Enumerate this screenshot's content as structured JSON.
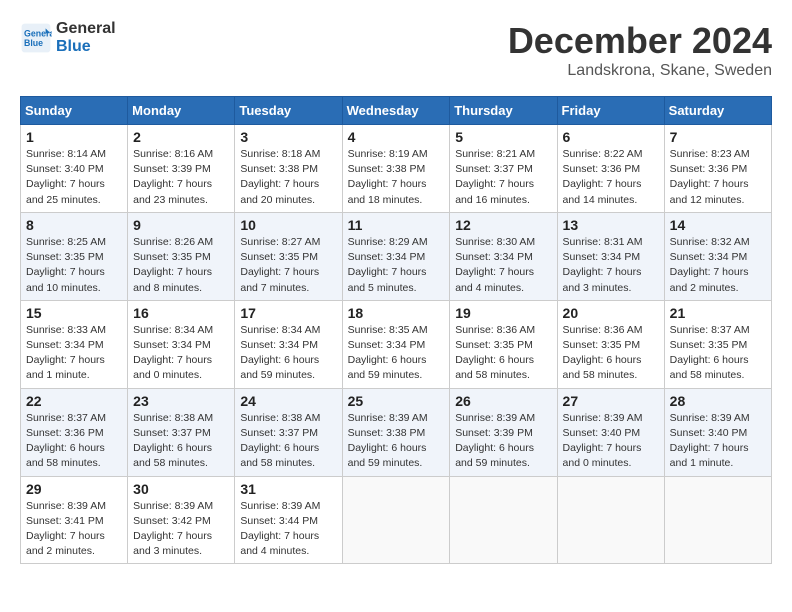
{
  "header": {
    "logo_line1": "General",
    "logo_line2": "Blue",
    "month_title": "December 2024",
    "location": "Landskrona, Skane, Sweden"
  },
  "days_of_week": [
    "Sunday",
    "Monday",
    "Tuesday",
    "Wednesday",
    "Thursday",
    "Friday",
    "Saturday"
  ],
  "weeks": [
    [
      {
        "day": "1",
        "sunrise": "8:14 AM",
        "sunset": "3:40 PM",
        "daylight": "7 hours and 25 minutes."
      },
      {
        "day": "2",
        "sunrise": "8:16 AM",
        "sunset": "3:39 PM",
        "daylight": "7 hours and 23 minutes."
      },
      {
        "day": "3",
        "sunrise": "8:18 AM",
        "sunset": "3:38 PM",
        "daylight": "7 hours and 20 minutes."
      },
      {
        "day": "4",
        "sunrise": "8:19 AM",
        "sunset": "3:38 PM",
        "daylight": "7 hours and 18 minutes."
      },
      {
        "day": "5",
        "sunrise": "8:21 AM",
        "sunset": "3:37 PM",
        "daylight": "7 hours and 16 minutes."
      },
      {
        "day": "6",
        "sunrise": "8:22 AM",
        "sunset": "3:36 PM",
        "daylight": "7 hours and 14 minutes."
      },
      {
        "day": "7",
        "sunrise": "8:23 AM",
        "sunset": "3:36 PM",
        "daylight": "7 hours and 12 minutes."
      }
    ],
    [
      {
        "day": "8",
        "sunrise": "8:25 AM",
        "sunset": "3:35 PM",
        "daylight": "7 hours and 10 minutes."
      },
      {
        "day": "9",
        "sunrise": "8:26 AM",
        "sunset": "3:35 PM",
        "daylight": "7 hours and 8 minutes."
      },
      {
        "day": "10",
        "sunrise": "8:27 AM",
        "sunset": "3:35 PM",
        "daylight": "7 hours and 7 minutes."
      },
      {
        "day": "11",
        "sunrise": "8:29 AM",
        "sunset": "3:34 PM",
        "daylight": "7 hours and 5 minutes."
      },
      {
        "day": "12",
        "sunrise": "8:30 AM",
        "sunset": "3:34 PM",
        "daylight": "7 hours and 4 minutes."
      },
      {
        "day": "13",
        "sunrise": "8:31 AM",
        "sunset": "3:34 PM",
        "daylight": "7 hours and 3 minutes."
      },
      {
        "day": "14",
        "sunrise": "8:32 AM",
        "sunset": "3:34 PM",
        "daylight": "7 hours and 2 minutes."
      }
    ],
    [
      {
        "day": "15",
        "sunrise": "8:33 AM",
        "sunset": "3:34 PM",
        "daylight": "7 hours and 1 minute."
      },
      {
        "day": "16",
        "sunrise": "8:34 AM",
        "sunset": "3:34 PM",
        "daylight": "7 hours and 0 minutes."
      },
      {
        "day": "17",
        "sunrise": "8:34 AM",
        "sunset": "3:34 PM",
        "daylight": "6 hours and 59 minutes."
      },
      {
        "day": "18",
        "sunrise": "8:35 AM",
        "sunset": "3:34 PM",
        "daylight": "6 hours and 59 minutes."
      },
      {
        "day": "19",
        "sunrise": "8:36 AM",
        "sunset": "3:35 PM",
        "daylight": "6 hours and 58 minutes."
      },
      {
        "day": "20",
        "sunrise": "8:36 AM",
        "sunset": "3:35 PM",
        "daylight": "6 hours and 58 minutes."
      },
      {
        "day": "21",
        "sunrise": "8:37 AM",
        "sunset": "3:35 PM",
        "daylight": "6 hours and 58 minutes."
      }
    ],
    [
      {
        "day": "22",
        "sunrise": "8:37 AM",
        "sunset": "3:36 PM",
        "daylight": "6 hours and 58 minutes."
      },
      {
        "day": "23",
        "sunrise": "8:38 AM",
        "sunset": "3:37 PM",
        "daylight": "6 hours and 58 minutes."
      },
      {
        "day": "24",
        "sunrise": "8:38 AM",
        "sunset": "3:37 PM",
        "daylight": "6 hours and 58 minutes."
      },
      {
        "day": "25",
        "sunrise": "8:39 AM",
        "sunset": "3:38 PM",
        "daylight": "6 hours and 59 minutes."
      },
      {
        "day": "26",
        "sunrise": "8:39 AM",
        "sunset": "3:39 PM",
        "daylight": "6 hours and 59 minutes."
      },
      {
        "day": "27",
        "sunrise": "8:39 AM",
        "sunset": "3:40 PM",
        "daylight": "7 hours and 0 minutes."
      },
      {
        "day": "28",
        "sunrise": "8:39 AM",
        "sunset": "3:40 PM",
        "daylight": "7 hours and 1 minute."
      }
    ],
    [
      {
        "day": "29",
        "sunrise": "8:39 AM",
        "sunset": "3:41 PM",
        "daylight": "7 hours and 2 minutes."
      },
      {
        "day": "30",
        "sunrise": "8:39 AM",
        "sunset": "3:42 PM",
        "daylight": "7 hours and 3 minutes."
      },
      {
        "day": "31",
        "sunrise": "8:39 AM",
        "sunset": "3:44 PM",
        "daylight": "7 hours and 4 minutes."
      },
      null,
      null,
      null,
      null
    ]
  ],
  "labels": {
    "sunrise": "Sunrise:",
    "sunset": "Sunset:",
    "daylight": "Daylight:"
  }
}
